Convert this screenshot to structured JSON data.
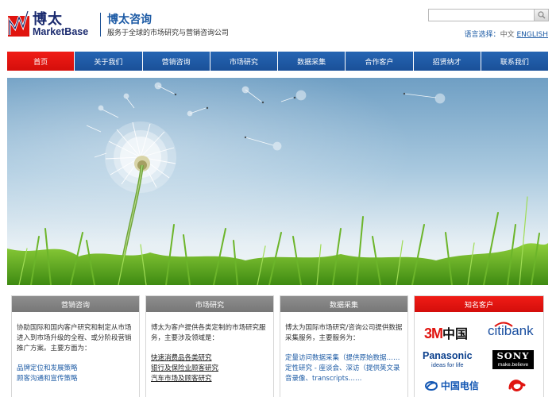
{
  "header": {
    "logo_cn": "博太",
    "logo_en": "MarketBase",
    "title": "博太咨询",
    "subtitle": "服务于全球的市场研究与营销咨询公司",
    "search_placeholder": "",
    "lang_label": "语言选择：",
    "lang_cn": "中文",
    "lang_en": "ENGLISH"
  },
  "nav": {
    "items": [
      "首页",
      "关于我们",
      "营销咨询",
      "市场研究",
      "数据采集",
      "合作客户",
      "招贤纳才",
      "联系我们"
    ],
    "active_index": 0
  },
  "boxes": {
    "marketing": {
      "title": "营销咨询",
      "intro": "协助国际和国内客户研究和制定从市场进入到市场升级的全程、或分阶段营销推广方案。主要方面为：",
      "links": [
        "品牌定位和发展策略",
        "顾客沟通和宣传策略"
      ]
    },
    "research": {
      "title": "市场研究",
      "intro": "博太为客户提供各类定制的市场研究服务，主要涉及领域是：",
      "links": [
        "快速消费品各类研究",
        "银行及保险业顾客研究",
        "汽车市场及顾客研究"
      ]
    },
    "data": {
      "title": "数据采集",
      "intro": "博太为国际市场研究/咨询公司提供数据采集服务，主要服务为：",
      "line1": "定量访问数据采集（提供原始数据……",
      "line2": "定性研究 - 座谈会、深访（提供英文录音录像、transcripts……"
    },
    "clients": {
      "title": "知名客户",
      "logos": {
        "threem": "3M",
        "threem_cn": "中国",
        "citi": "citibank",
        "panasonic": "Panasonic",
        "panasonic_tag": "ideas for life",
        "sony": "SONY",
        "sony_tag": "make.believe",
        "telecom": "中国电信"
      }
    }
  },
  "colors": {
    "brand_blue": "#1d5ba5",
    "nav_active_red": "#e0140f",
    "box_header_gray": "#808080"
  }
}
